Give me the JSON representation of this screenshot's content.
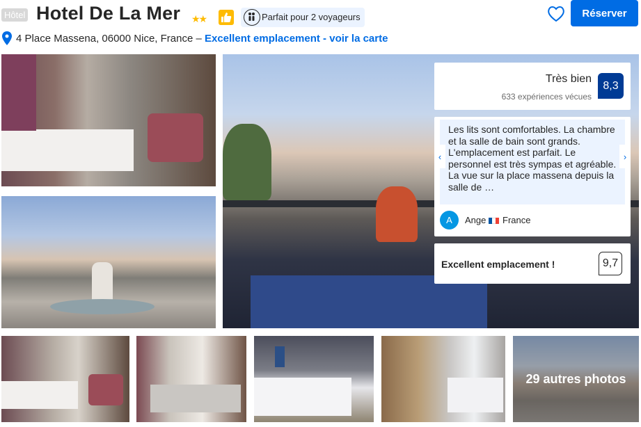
{
  "header": {
    "property_type": "Hôtel",
    "hotel_name": "Hotel De La Mer",
    "stars": "★★",
    "travelers_badge": "Parfait pour 2 voyageurs",
    "reserve_label": "Réserver",
    "address": "4 Place Massena, 06000 Nice, France – ",
    "location_link": "Excellent emplacement - voir la carte"
  },
  "rating": {
    "word": "Très bien",
    "count": "633 expériences vécues",
    "score": "8,3"
  },
  "review": {
    "text": "Les lits sont comfortables. La chambre et la salle de bain sont grands. L'emplacement est parfait. Le personnel est très sympas et agréable. La vue sur la place massena depuis la salle de …",
    "avatar_initial": "A",
    "reviewer": "Ange",
    "country": "France",
    "prev_arrow": "‹",
    "next_arrow": "›"
  },
  "location": {
    "label": "Excellent emplacement !",
    "score": "9,7"
  },
  "gallery": {
    "more_photos": "29 autres photos"
  },
  "icons": {
    "heart": "heart-icon",
    "pin": "map-pin-icon",
    "thumbs_up": "thumbs-up-icon",
    "travelers": "travelers-icon"
  },
  "colors": {
    "brand_blue": "#006ce4",
    "score_blue": "#003b95",
    "star_yellow": "#febb02",
    "pill_bg": "#ebf3ff"
  }
}
